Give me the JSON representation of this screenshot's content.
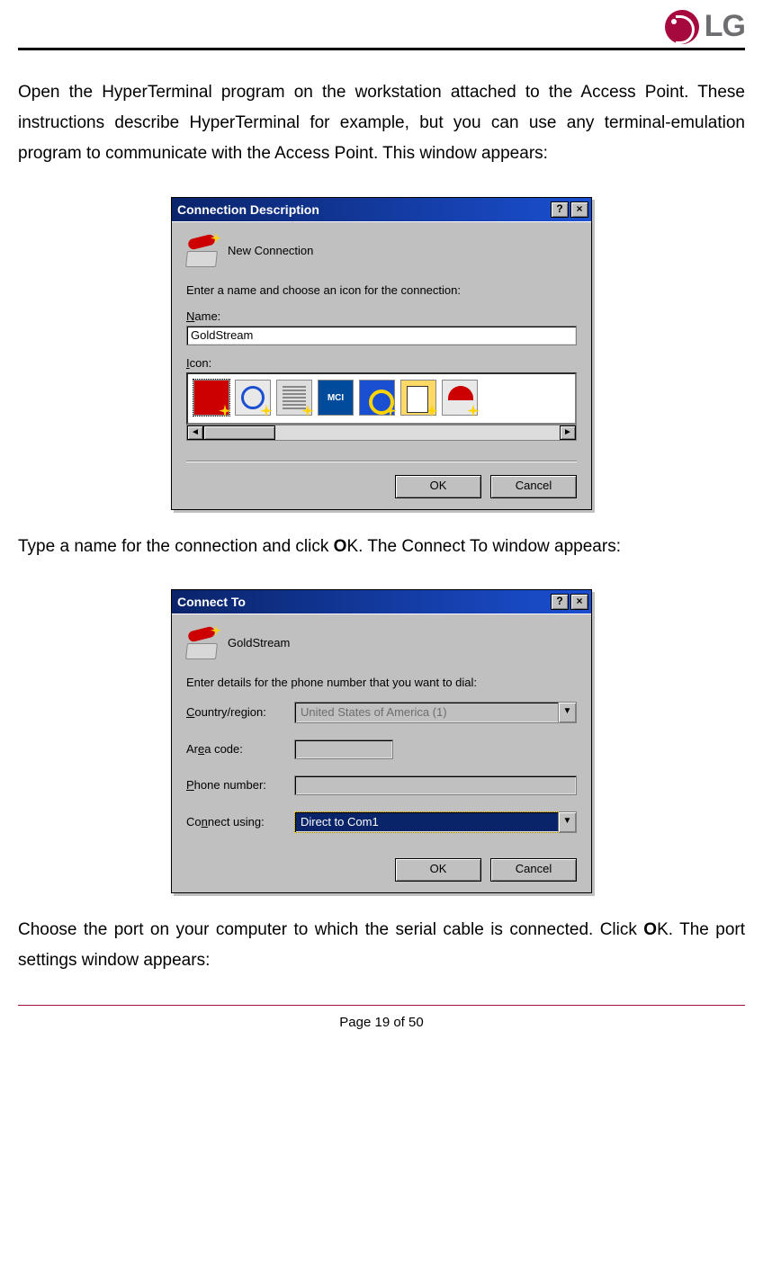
{
  "logo_text": "LG",
  "para1": "Open the HyperTerminal program on the workstation attached to the Access Point. These instructions describe HyperTerminal for example, but you can use any terminal-emulation program to communicate with the Access Point. This window appears:",
  "para2_pre": "Type a name for the connection and click ",
  "para2_bold": "O",
  "para2_post": "K. The Connect To window appears:",
  "para3_pre": "Choose the port on your computer to which the serial cable is connected. Click ",
  "para3_bold": "O",
  "para3_post": "K. The port settings window appears:",
  "footer": "Page 19 of 50",
  "dlg1": {
    "title": "Connection Description",
    "help": "?",
    "close": "×",
    "icon_label": "New Connection",
    "prompt": "Enter a name and choose an icon for the connection:",
    "name_label_u": "N",
    "name_label_rest": "ame:",
    "name_value": "GoldStream",
    "icon_label_u": "I",
    "icon_label_rest": "con:",
    "mci_text": "MCI",
    "scroll_left": "◄",
    "scroll_right": "►",
    "ok": "OK",
    "cancel": "Cancel"
  },
  "dlg2": {
    "title": "Connect To",
    "help": "?",
    "close": "×",
    "conn_name": "GoldStream",
    "prompt": "Enter details for the phone number that you want to dial:",
    "country_u": "C",
    "country_rest": "ountry/region:",
    "country_value": "United States of America (1)",
    "area_pre": "Ar",
    "area_u": "e",
    "area_post": "a code:",
    "area_value": "",
    "phone_u": "P",
    "phone_rest": "hone number:",
    "phone_value": "",
    "connect_pre": "Co",
    "connect_u": "n",
    "connect_post": "nect using:",
    "connect_value": "Direct to Com1",
    "ok": "OK",
    "cancel": "Cancel"
  }
}
